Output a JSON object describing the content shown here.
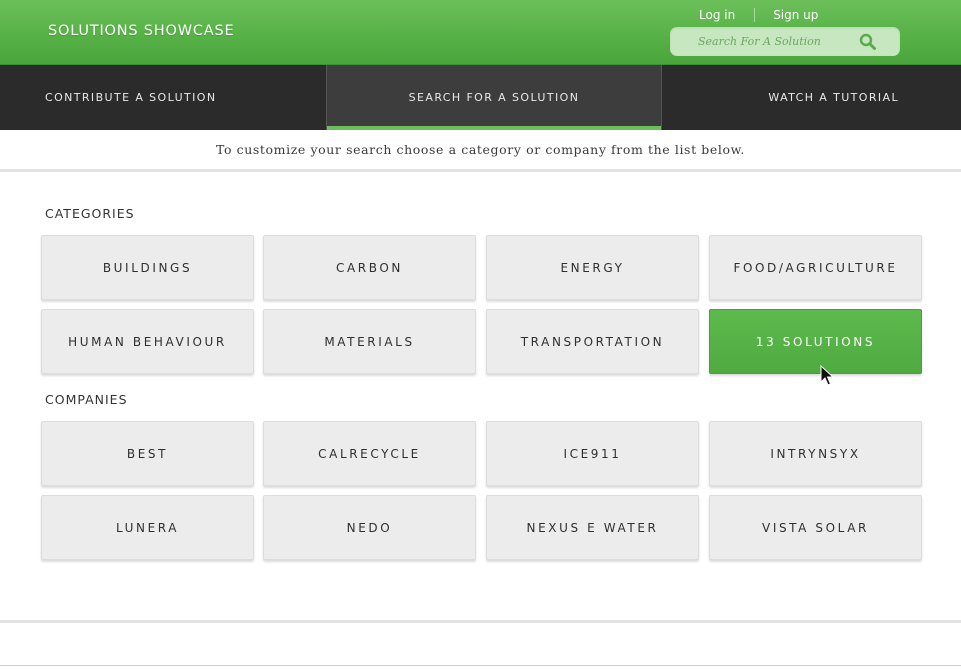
{
  "header": {
    "brand": "SOLUTIONS SHOWCASE",
    "login_label": "Log in",
    "signup_label": "Sign up",
    "search_placeholder": "Search For A Solution",
    "search_icon": "search-icon"
  },
  "nav": {
    "tabs": [
      {
        "label": "CONTRIBUTE A SOLUTION"
      },
      {
        "label": "SEARCH FOR A SOLUTION",
        "active": true
      },
      {
        "label": "WATCH A TUTORIAL"
      }
    ]
  },
  "intro_text": "To customize your search choose a category or company from the list below.",
  "categories": {
    "title": "CATEGORIES",
    "items": [
      "BUILDINGS",
      "CARBON",
      "ENERGY",
      "FOOD/AGRICULTURE",
      "HUMAN BEHAVIOUR",
      "MATERIALS",
      "TRANSPORTATION",
      "13 SOLUTIONS"
    ]
  },
  "companies": {
    "title": "COMPANIES",
    "items": [
      "BEST",
      "CALRECYCLE",
      "ICE911",
      "INTRYNSYX",
      "LUNERA",
      "NEDO",
      "NEXUS E WATER",
      "VISTA SOLAR"
    ]
  },
  "colors": {
    "accent": "#55b045",
    "nav_bg": "#2b2b2b",
    "tile_bg": "#ececec"
  }
}
